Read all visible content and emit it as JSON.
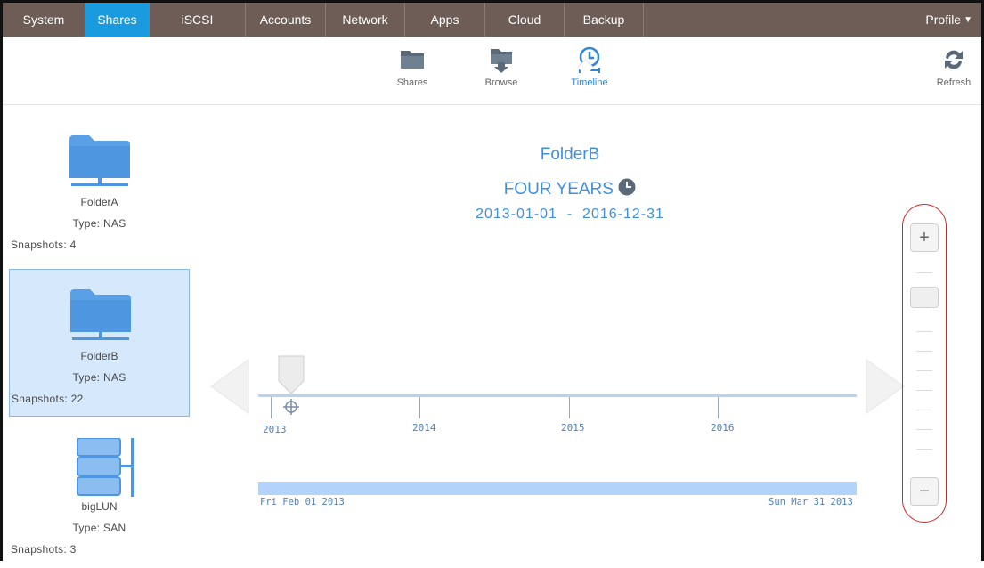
{
  "nav": {
    "tabs": [
      {
        "label": "System",
        "active": false
      },
      {
        "label": "Shares",
        "active": true
      },
      {
        "label": "iSCSI",
        "active": false
      },
      {
        "label": "Accounts",
        "active": false
      },
      {
        "label": "Network",
        "active": false
      },
      {
        "label": "Apps",
        "active": false
      },
      {
        "label": "Cloud",
        "active": false
      },
      {
        "label": "Backup",
        "active": false
      }
    ],
    "profile": "Profile"
  },
  "toolbar": {
    "shares": "Shares",
    "browse": "Browse",
    "timeline": "Timeline",
    "refresh": "Refresh",
    "active": "Timeline"
  },
  "shares": [
    {
      "name": "FolderA",
      "type": "Type: NAS",
      "snapshots": "Snapshots: 4",
      "icon": "folder-icon",
      "selected": false
    },
    {
      "name": "FolderB",
      "type": "Type: NAS",
      "snapshots": "Snapshots: 22",
      "icon": "folder-icon",
      "selected": true
    },
    {
      "name": "bigLUN",
      "type": "Type: SAN",
      "snapshots": "Snapshots: 3",
      "icon": "lun-icon",
      "selected": false
    }
  ],
  "timeline": {
    "folder": "FolderB",
    "range_name": "FOUR YEARS",
    "range_dates": "2013-01-01  -  2016-12-31",
    "years": [
      "2013",
      "2014",
      "2015",
      "2016"
    ],
    "range_start": "Fri Feb 01 2013",
    "range_end": "Sun Mar 31 2013"
  },
  "zoom": {
    "plus": "+",
    "minus": "−"
  },
  "colors": {
    "nav_bg": "#6d5d56",
    "nav_active": "#1a9be0",
    "accent": "#3f8fe0",
    "selected_bg": "#d6e8fc"
  }
}
